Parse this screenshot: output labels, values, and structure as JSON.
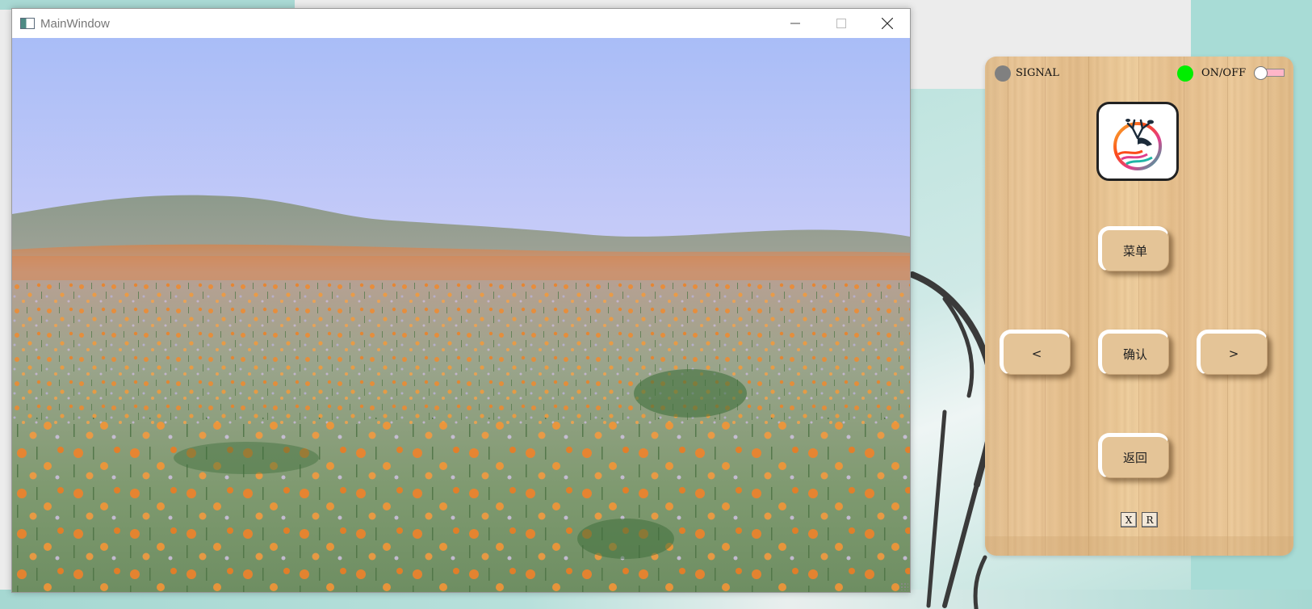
{
  "window": {
    "title": "MainWindow",
    "minimize_icon": "minimize-icon",
    "maximize_icon": "maximize-icon",
    "close_icon": "close-icon"
  },
  "content": {
    "image": "landscape-photo",
    "description_icon": "poppy-field"
  },
  "remote": {
    "signal": {
      "label": "SIGNAL",
      "color": "#808080"
    },
    "power": {
      "label": "ON/OFF",
      "color": "#00ee00"
    },
    "toggle": {
      "track_color": "#ffb6c8",
      "state": "off"
    },
    "logo_icon": "deer-logo-icon",
    "buttons": {
      "menu": "菜单",
      "left": "<",
      "ok": "确认",
      "right": ">",
      "back": "返回"
    },
    "small_buttons": {
      "x": "X",
      "r": "R"
    }
  },
  "colors": {
    "wood": "#e8c594",
    "window_title": "#777777"
  }
}
